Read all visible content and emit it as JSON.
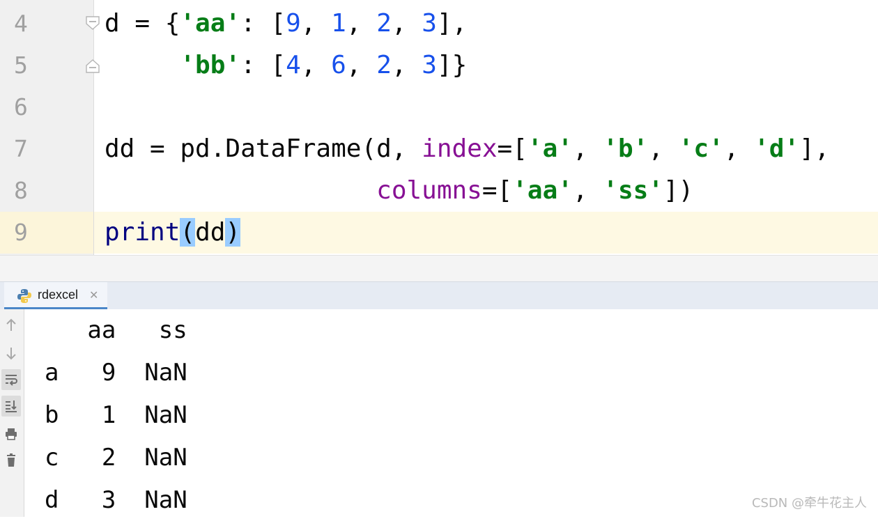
{
  "editor": {
    "line_numbers": [
      "4",
      "5",
      "6",
      "7",
      "8",
      "9"
    ],
    "lines": [
      {
        "segments": [
          {
            "t": "d = {",
            "c": ""
          },
          {
            "t": "'aa'",
            "c": "str"
          },
          {
            "t": ": [",
            "c": ""
          },
          {
            "t": "9",
            "c": "num"
          },
          {
            "t": ", ",
            "c": ""
          },
          {
            "t": "1",
            "c": "num"
          },
          {
            "t": ", ",
            "c": ""
          },
          {
            "t": "2",
            "c": "num"
          },
          {
            "t": ", ",
            "c": ""
          },
          {
            "t": "3",
            "c": "num"
          },
          {
            "t": "],",
            "c": ""
          }
        ]
      },
      {
        "segments": [
          {
            "t": "     ",
            "c": ""
          },
          {
            "t": "'bb'",
            "c": "str"
          },
          {
            "t": ": [",
            "c": ""
          },
          {
            "t": "4",
            "c": "num"
          },
          {
            "t": ", ",
            "c": ""
          },
          {
            "t": "6",
            "c": "num"
          },
          {
            "t": ", ",
            "c": ""
          },
          {
            "t": "2",
            "c": "num"
          },
          {
            "t": ", ",
            "c": ""
          },
          {
            "t": "3",
            "c": "num"
          },
          {
            "t": "]}",
            "c": ""
          }
        ]
      },
      {
        "segments": []
      },
      {
        "segments": [
          {
            "t": "dd = pd.DataFrame(d, ",
            "c": ""
          },
          {
            "t": "index",
            "c": "kw"
          },
          {
            "t": "=[",
            "c": ""
          },
          {
            "t": "'a'",
            "c": "str"
          },
          {
            "t": ", ",
            "c": ""
          },
          {
            "t": "'b'",
            "c": "str"
          },
          {
            "t": ", ",
            "c": ""
          },
          {
            "t": "'c'",
            "c": "str"
          },
          {
            "t": ", ",
            "c": ""
          },
          {
            "t": "'d'",
            "c": "str"
          },
          {
            "t": "],",
            "c": ""
          }
        ]
      },
      {
        "segments": [
          {
            "t": "                  ",
            "c": ""
          },
          {
            "t": "columns",
            "c": "kw"
          },
          {
            "t": "=[",
            "c": ""
          },
          {
            "t": "'aa'",
            "c": "str"
          },
          {
            "t": ", ",
            "c": ""
          },
          {
            "t": "'ss'",
            "c": "str"
          },
          {
            "t": "])",
            "c": ""
          }
        ]
      },
      {
        "segments": [
          {
            "t": "print",
            "c": "fn"
          },
          {
            "t": "(",
            "c": "brace"
          },
          {
            "t": "dd",
            "c": ""
          },
          {
            "t": ")",
            "c": "brace"
          }
        ]
      }
    ],
    "current_line_index": 5
  },
  "run_tab": {
    "label": "rdexcel",
    "close_glyph": "✕",
    "icon": "python-icon"
  },
  "console_toolbar": [
    {
      "name": "up-arrow-icon",
      "glyph": "↑",
      "active": false
    },
    {
      "name": "down-arrow-icon",
      "glyph": "↓",
      "active": false
    },
    {
      "name": "soft-wrap-icon",
      "glyph": "soft-wrap",
      "active": true
    },
    {
      "name": "scroll-to-end-icon",
      "glyph": "scroll-end",
      "active": true
    },
    {
      "name": "print-icon",
      "glyph": "print",
      "active": false
    },
    {
      "name": "trash-icon",
      "glyph": "trash",
      "active": false
    }
  ],
  "console_output": [
    "   aa   ss",
    "a   9  NaN",
    "b   1  NaN",
    "c   2  NaN",
    "d   3  NaN"
  ],
  "watermark": "CSDN @牵牛花主人",
  "colors": {
    "string": "#067d17",
    "number": "#1750eb",
    "keyword_arg": "#871094",
    "builtin": "#000080",
    "brace_match": "#99ccff",
    "current_line": "#fef9e3"
  }
}
